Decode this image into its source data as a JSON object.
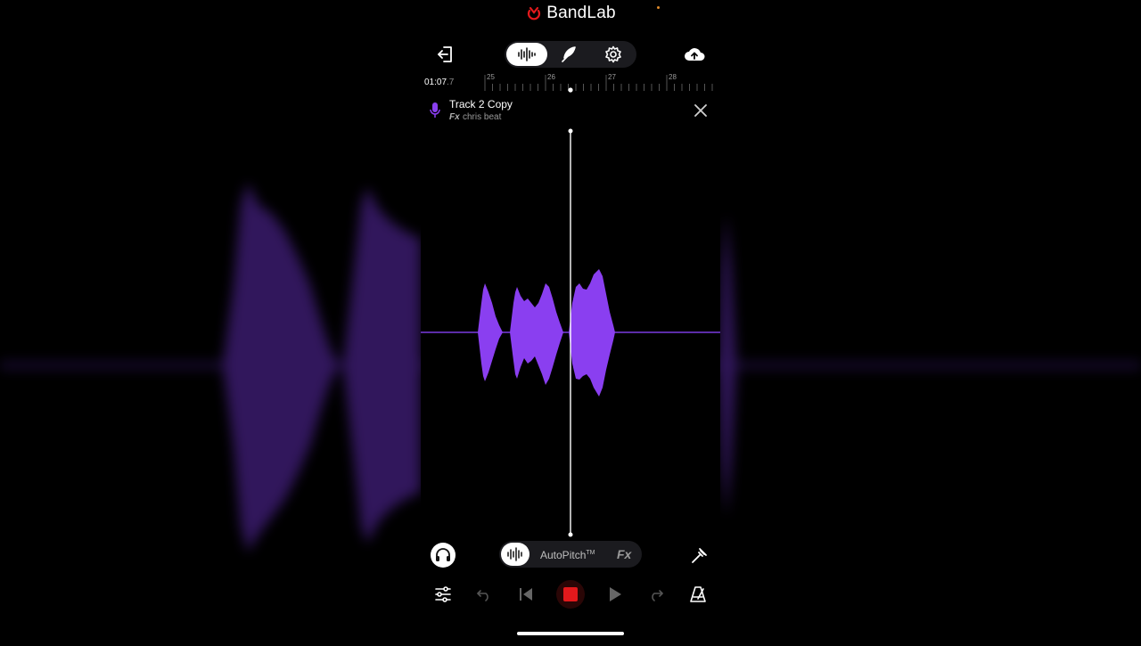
{
  "brand": {
    "name": "BandLab"
  },
  "toolbar": {
    "exit": "exit-icon",
    "modes": [
      "waveform-icon",
      "quill-icon",
      "settings-icon"
    ],
    "active_mode": "waveform",
    "upload": "cloud-upload-icon"
  },
  "timeline": {
    "time_main": "01:07",
    "time_fraction": ".7",
    "ticks": [
      "25",
      "26",
      "27",
      "28"
    ]
  },
  "track": {
    "name": "Track 2 Copy",
    "fx_label": "Fx",
    "fx_preset": "chris beat",
    "icon": "microphone-icon",
    "color": "#8a3ff0"
  },
  "effects_bar": {
    "monitor": "headphones-icon",
    "autopitch_label": "AutoPitch",
    "autopitch_tm": "TM",
    "fx_label": "Fx",
    "tuner": "tuning-fork-icon"
  },
  "transport": {
    "mixer": "sliders-icon",
    "undo": "undo-icon",
    "rewind": "skip-back-icon",
    "record": "stop-record-icon",
    "play": "play-icon",
    "redo": "redo-icon",
    "metronome": "metronome-icon",
    "record_color": "#e3191c"
  },
  "colors": {
    "accent": "#8a3ff0",
    "background": "#000000"
  }
}
